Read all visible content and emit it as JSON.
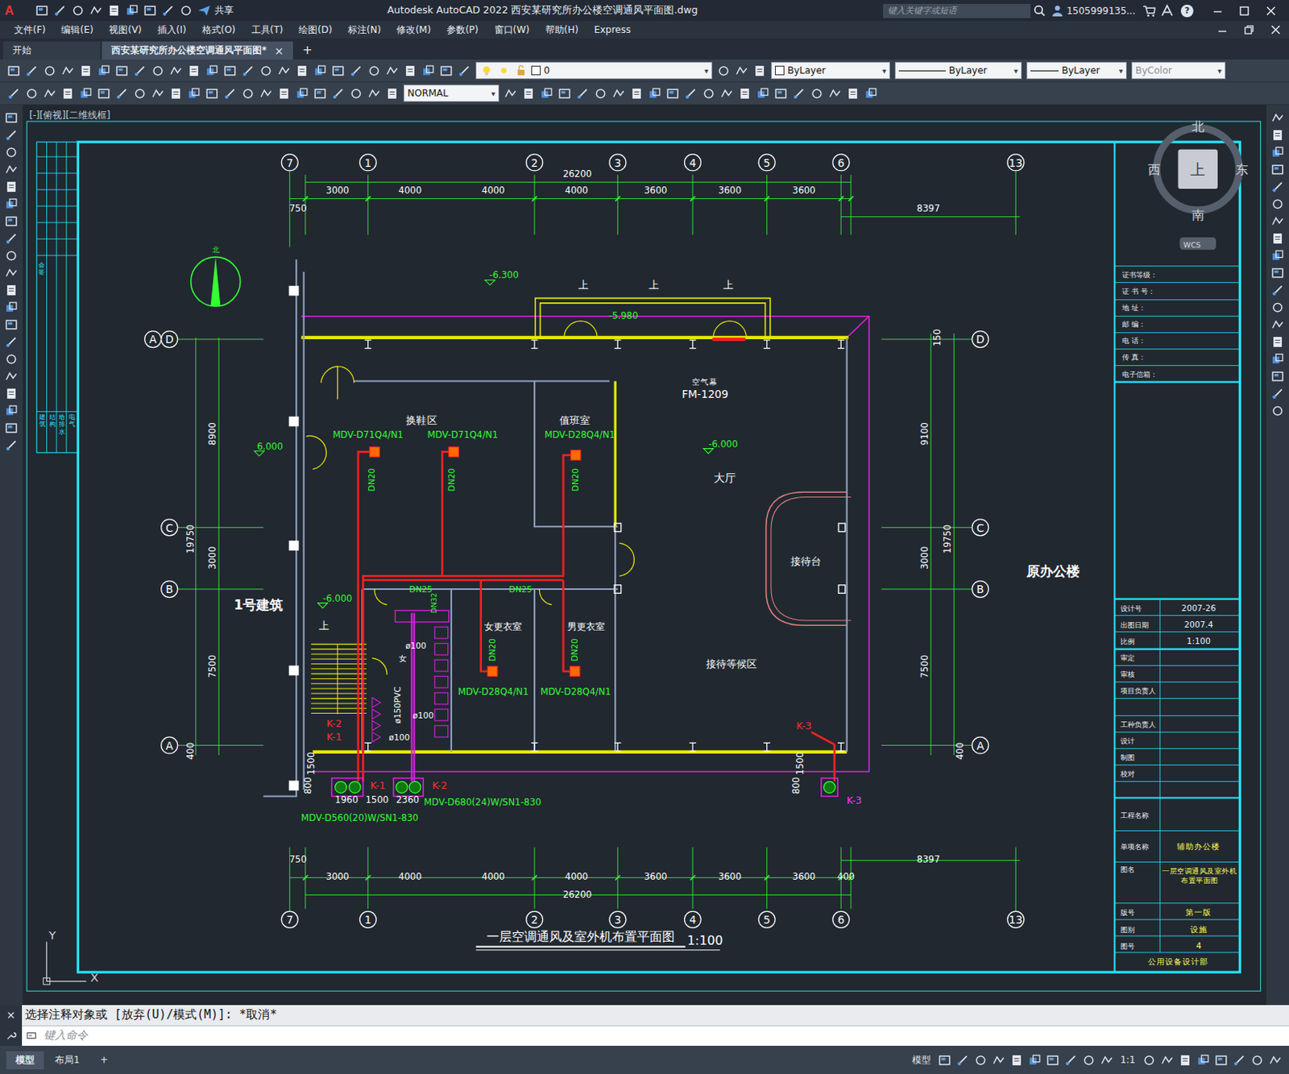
{
  "window": {
    "logo": "A",
    "title": "Autodesk AutoCAD 2022   西安某研究所办公楼空调通风平面图.dwg",
    "share": "共享",
    "search_placeholder": "键入关键字或短语",
    "user": "1505999135...",
    "help": "?"
  },
  "menus": [
    "文件(F)",
    "编辑(E)",
    "视图(V)",
    "插入(I)",
    "格式(O)",
    "工具(T)",
    "绘图(D)",
    "标注(N)",
    "修改(M)",
    "参数(P)",
    "窗口(W)",
    "帮助(H)",
    "Express"
  ],
  "tabs": [
    {
      "label": "开始",
      "selected": false
    },
    {
      "label": "西安某研究所办公楼空调通风平面图*",
      "selected": true
    }
  ],
  "tab_close": "×",
  "tab_add": "+",
  "properties": {
    "layer": "0",
    "color": "ByLayer",
    "linetype": "ByLayer",
    "lineweight": "ByLayer",
    "plotstyle": "ByColor",
    "plotstyle_disabled": true,
    "textstyle": "NORMAL"
  },
  "drawing": {
    "viewport_label": "[-][俯视][二维线框]",
    "grid_bubbles": [
      "7",
      "1",
      "2",
      "3",
      "4",
      "5",
      "6",
      "13",
      "7",
      "1",
      "2",
      "3",
      "4",
      "5",
      "6",
      "13",
      "A",
      "D",
      "C",
      "B",
      "A",
      "D",
      "C",
      "B",
      "A"
    ],
    "dimensions": [
      "26200",
      "3000",
      "4000",
      "4000",
      "4000",
      "3600",
      "3600",
      "3600",
      "750",
      "8397",
      "750",
      "3000",
      "4000",
      "4000",
      "4000",
      "3600",
      "3600",
      "3600",
      "400",
      "26200",
      "8397",
      "8900",
      "19750",
      "3000",
      "7500",
      "400",
      "150",
      "9100",
      "19750",
      "3000",
      "7500",
      "400",
      "1960",
      "1500",
      "2360",
      "800",
      "1500",
      "800",
      "1500"
    ],
    "labels": [
      {
        "text": "-6.300",
        "color": "#33ff33"
      },
      {
        "text": "-5.980",
        "color": "#33ff33"
      },
      {
        "text": "6.000",
        "color": "#33ff33"
      },
      {
        "text": "-6.000",
        "color": "#33ff33"
      },
      {
        "text": "-6.000",
        "color": "#33ff33"
      },
      {
        "text": "上",
        "color": "#ffffff"
      },
      {
        "text": "上",
        "color": "#ffffff"
      },
      {
        "text": "上",
        "color": "#ffffff"
      },
      {
        "text": "上",
        "color": "#ffffff"
      },
      {
        "text": "空气幕",
        "color": "#ffffff"
      },
      {
        "text": "FM-1209",
        "color": "#ffffff"
      },
      {
        "text": "换鞋区",
        "color": "#ffffff"
      },
      {
        "text": "值班室",
        "color": "#ffffff"
      },
      {
        "text": "大厅",
        "color": "#ffffff"
      },
      {
        "text": "接待台",
        "color": "#ffffff"
      },
      {
        "text": "接待等候区",
        "color": "#ffffff"
      },
      {
        "text": "女更衣室",
        "color": "#ffffff"
      },
      {
        "text": "男更衣室",
        "color": "#ffffff"
      },
      {
        "text": "1号建筑",
        "color": "#ffffff"
      },
      {
        "text": "原办公楼",
        "color": "#ffffff"
      },
      {
        "text": "MDV-D71Q4/N1",
        "color": "#33ff33"
      },
      {
        "text": "MDV-D71Q4/N1",
        "color": "#33ff33"
      },
      {
        "text": "MDV-D28Q4/N1",
        "color": "#33ff33"
      },
      {
        "text": "MDV-D28Q4/N1",
        "color": "#33ff33"
      },
      {
        "text": "MDV-D28Q4/N1",
        "color": "#33ff33"
      },
      {
        "text": "DN20",
        "color": "#33ff33"
      },
      {
        "text": "DN20",
        "color": "#33ff33"
      },
      {
        "text": "DN20",
        "color": "#33ff33"
      },
      {
        "text": "DN20",
        "color": "#33ff33"
      },
      {
        "text": "DN20",
        "color": "#33ff33"
      },
      {
        "text": "DN25",
        "color": "#33ff33"
      },
      {
        "text": "DN25",
        "color": "#33ff33"
      },
      {
        "text": "DN32",
        "color": "#33ff33"
      },
      {
        "text": "MDV-D560(20)W/SN1-830",
        "color": "#33ff33"
      },
      {
        "text": "MDV-D680(24)W/SN1-830",
        "color": "#33ff33"
      },
      {
        "text": "K-2",
        "color": "#ff3030"
      },
      {
        "text": "K-1",
        "color": "#ff3030"
      },
      {
        "text": "K-1",
        "color": "#ff3030"
      },
      {
        "text": "K-2",
        "color": "#ff3030"
      },
      {
        "text": "K-3",
        "color": "#ff3030"
      },
      {
        "text": "K-3",
        "color": "#ff33ff"
      },
      {
        "text": "ø100",
        "color": "#ffffff"
      },
      {
        "text": "ø150PVC",
        "color": "#ffffff"
      },
      {
        "text": "ø100",
        "color": "#ffffff"
      },
      {
        "text": "ø100",
        "color": "#ffffff"
      },
      {
        "text": "女",
        "color": "#ffffff"
      }
    ],
    "compass": {
      "north": "北",
      "south": "南",
      "west": "西",
      "east": "东",
      "top": "上",
      "wcs": "WCS"
    },
    "north_arrow": "北",
    "sign_column": {
      "title": "会签",
      "entries": [
        "建筑",
        "结构",
        "给排水",
        "电气"
      ]
    },
    "title_block": {
      "info_rows": [
        "证书等级：",
        "证 书 号：",
        "地    址：",
        "邮    编：",
        "电    话：",
        "传    真：",
        "电子信箱："
      ],
      "rows": [
        {
          "label": "设计号",
          "value": "2007-26"
        },
        {
          "label": "出图日期",
          "value": "2007.4"
        },
        {
          "label": "比例",
          "value": "1:100"
        },
        {
          "label": "审定"
        },
        {
          "label": "审核"
        },
        {
          "label": "项目负责人"
        },
        {
          "label": "工种负责人"
        },
        {
          "label": "设计"
        },
        {
          "label": "制图"
        },
        {
          "label": "校对"
        },
        {
          "label": "工程名称"
        },
        {
          "label": "单项名称",
          "value": "辅助办公楼"
        },
        {
          "label": "图名",
          "value": "一层空调通风及室外机布置平面图"
        },
        {
          "label": "版号",
          "value": "第一版"
        },
        {
          "label": "图别",
          "value": "设施"
        },
        {
          "label": "图号",
          "value": "4"
        }
      ],
      "footer": "公用设备设计部"
    },
    "drawing_title": "一层空调通风及室外机布置平面图",
    "drawing_scale": "1:100",
    "ucs": {
      "y": "Y",
      "x": "X"
    }
  },
  "command": {
    "history": "选择注释对象或 [放弃(U)/模式(M)]: *取消*",
    "placeholder": "键入命令"
  },
  "status_bar": {
    "layouts": [
      {
        "label": "模型",
        "selected": true
      },
      {
        "label": "布局1",
        "selected": false
      }
    ],
    "add": "+",
    "space": "模型",
    "scale": "1:1"
  }
}
